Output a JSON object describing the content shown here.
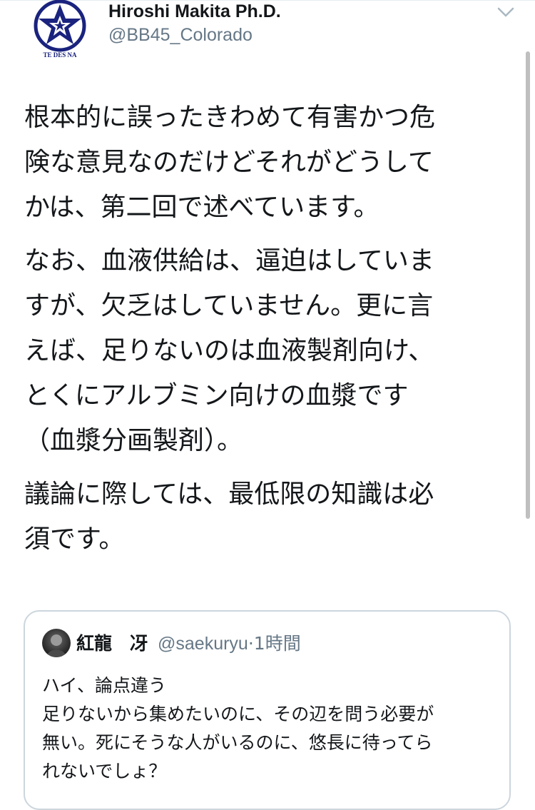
{
  "tweet": {
    "author": {
      "display_name": "Hiroshi Makita Ph.D.",
      "handle": "@BB45_Colorado",
      "avatar_text": "TE DES NA",
      "avatar_color": "#1a237e"
    },
    "menu_icon": "chevron-down-icon",
    "paragraphs": [
      "根本的に誤ったきわめて有害かつ危\n険な意見なのだけどそれがどうして\nかは、第二回で述べています。",
      "なお、血液供給は、逼迫はしていま\nすが、欠乏はしていません。更に言\nえば、足りないのは血液製剤向け、\nとくにアルブミン向けの血漿です\n（血漿分画製剤）。",
      "議論に際しては、最低限の知識は必\n須です。"
    ]
  },
  "quoted_tweet": {
    "author": {
      "display_name": "紅龍　冴",
      "handle": "@saekuryu",
      "separator": "·",
      "time": "1時間"
    },
    "text": "ハイ、論点違う\n足りないから集めたいのに、その辺を問う必要が\n無い。死にそうな人がいるのに、悠長に待ってら\nれないでしょ？"
  },
  "colors": {
    "text": "#14171a",
    "secondary": "#657786",
    "border": "#ccd6dd",
    "avatar_blue": "#1a237e"
  }
}
